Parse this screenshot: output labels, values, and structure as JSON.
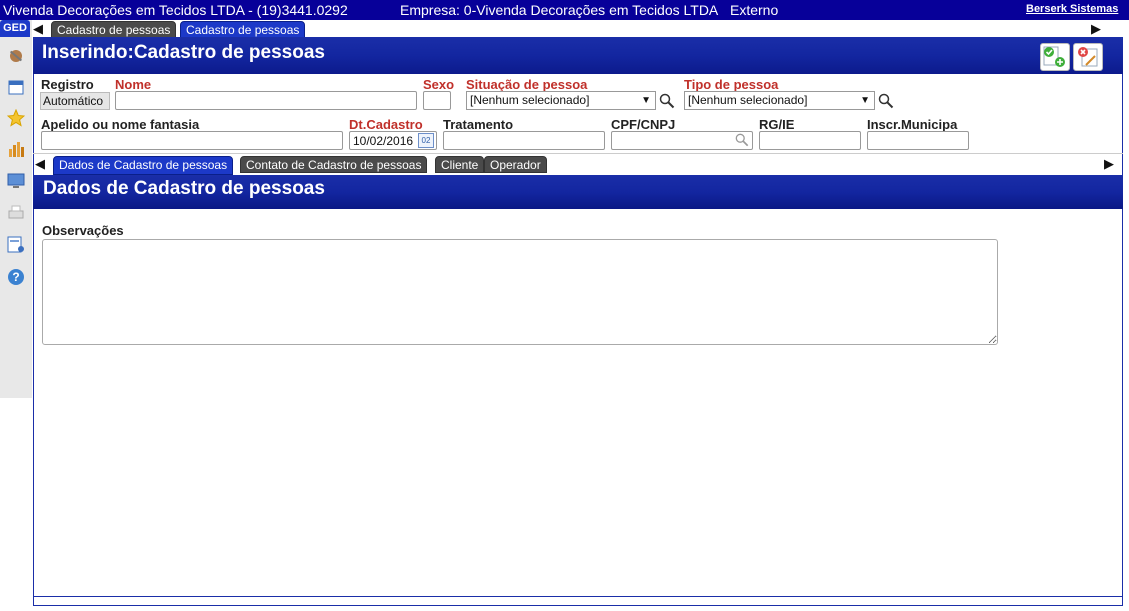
{
  "topbar": {
    "company_phone": "Vivenda Decorações em Tecidos LTDA - (19)3441.0292",
    "empresa": "Empresa: 0-Vivenda Decorações em Tecidos LTDA",
    "mode": "Externo",
    "vendor_link": "Berserk Sistemas"
  },
  "sidebar": {
    "ged_label": "GED",
    "icons": [
      "tools-icon",
      "calendar-icon",
      "star-icon",
      "bar-chart-icon",
      "monitor-icon",
      "printer-icon",
      "report-user-icon",
      "help-icon"
    ]
  },
  "top_tabs": [
    {
      "label": "Cadastro de pessoas",
      "active": false
    },
    {
      "label": "Cadastro de pessoas",
      "active": true
    }
  ],
  "header": {
    "title": "Inserindo:Cadastro de pessoas",
    "buttons": [
      "save-add-icon",
      "cancel-edit-icon"
    ]
  },
  "form": {
    "registro_label": "Registro",
    "registro_value": "Automático",
    "nome_label": "Nome",
    "nome_value": "",
    "sexo_label": "Sexo",
    "sexo_value": "",
    "situacao_label": "Situação de pessoa",
    "situacao_value": "[Nenhum selecionado]",
    "tipo_label": "Tipo de pessoa",
    "tipo_value": "[Nenhum selecionado]",
    "apelido_label": "Apelido ou nome fantasia",
    "apelido_value": "",
    "dtcadastro_label": "Dt.Cadastro",
    "dtcadastro_value": "10/02/2016",
    "calendar_day": "02",
    "tratamento_label": "Tratamento",
    "tratamento_value": "",
    "cpf_label": "CPF/CNPJ",
    "cpf_value": "",
    "rg_label": "RG/IE",
    "rg_value": "",
    "inscr_label": "Inscr.Municipa",
    "inscr_value": ""
  },
  "section_tabs": [
    {
      "label": "Dados de Cadastro de pessoas",
      "active": true
    },
    {
      "label": "Contato de Cadastro de pessoas",
      "active": false
    },
    {
      "label": "Cliente",
      "active": false
    },
    {
      "label": "Operador",
      "active": false
    }
  ],
  "section": {
    "title": "Dados de Cadastro de pessoas",
    "obs_label": "Observações",
    "obs_value": ""
  },
  "colors": {
    "brand_blue": "#070099",
    "band_blue": "#1326a0",
    "required_red": "#c0302a"
  }
}
